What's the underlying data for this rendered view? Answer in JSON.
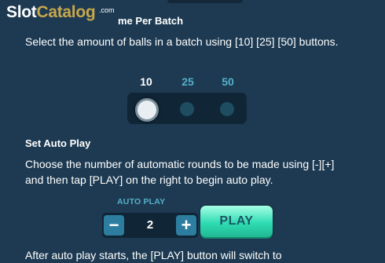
{
  "watermark": {
    "slot": "Slot",
    "catalog": "Catalog",
    "com": ".com"
  },
  "batch_section": {
    "title_visible": "me Per Batch",
    "description": "Select the amount of balls in a batch using [10] [25] [50] buttons.",
    "options": [
      "10",
      "25",
      "50"
    ],
    "selected": "10"
  },
  "auto_play_section": {
    "title": "Set Auto Play",
    "description": "Choose the number of automatic rounds to be made using [-][+] and then tap [PLAY] on the right to begin auto play.",
    "stepper_label": "AUTO PLAY",
    "minus_label": "−",
    "plus_label": "+",
    "value": "2",
    "play_label": "PLAY"
  },
  "cut_off_text": "After auto play starts, the [PLAY] button will switch to",
  "colors": {
    "background": "#1d3a52",
    "accent": "#54b0c9",
    "play_button": "#2fdcb3",
    "stepper_button": "#2d7da0"
  }
}
